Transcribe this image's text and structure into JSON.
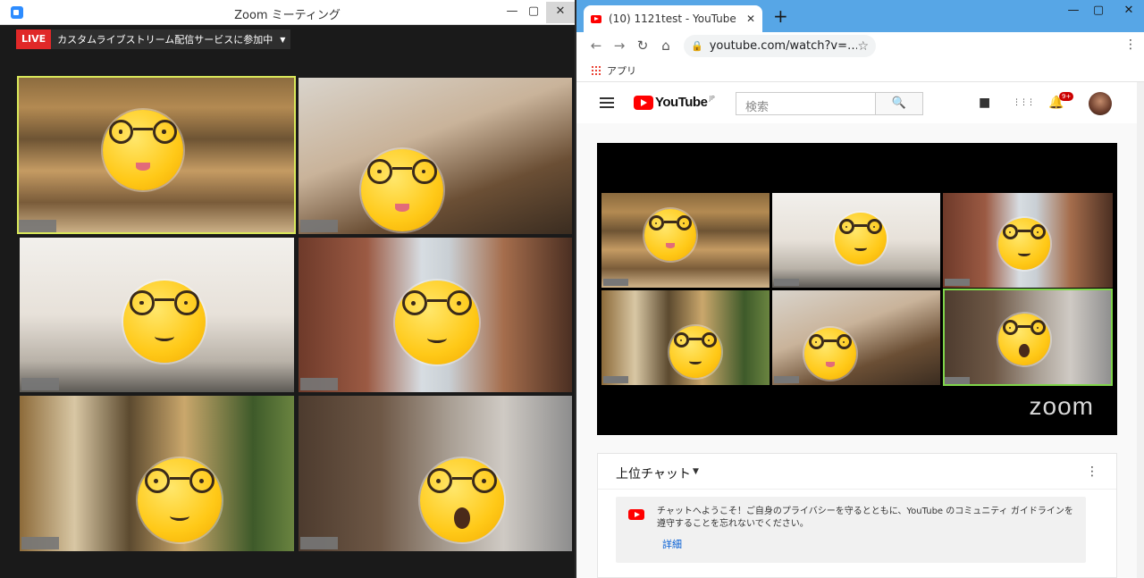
{
  "zoom": {
    "title": "Zoom ミーティング",
    "controls": {
      "minimize": "—",
      "maximize": "▢",
      "close": "✕"
    },
    "live_badge": "LIVE",
    "live_text": "カスタムライブストリーム配信サービスに参加中",
    "live_caret": "▼"
  },
  "chrome": {
    "tab_title": "(10) 1121test - YouTube",
    "tab_close": "✕",
    "new_tab": "+",
    "window_controls": {
      "minimize": "—",
      "maximize": "▢",
      "close": "✕"
    },
    "nav": {
      "back": "←",
      "forward": "→",
      "reload": "↻",
      "home": "⌂"
    },
    "lock": "🔒",
    "url": "youtube.com/watch?v=…",
    "star": "☆",
    "menu": "⋮",
    "bookmark_apps": "アプリ"
  },
  "youtube": {
    "logo_text": "YouTube",
    "logo_region": "JP",
    "search_placeholder": "検索",
    "search_icon": "🔍",
    "icons": {
      "create": "■",
      "apps": "⋮⋮⋮",
      "bell": "🔔",
      "notif_count": "9+"
    },
    "player_watermark": "zoom",
    "chat": {
      "title": "上位チャット",
      "caret": "▼",
      "menu": "⋮",
      "welcome": "チャットへようこそ！ご自身のプライバシーを守るとともに、YouTube のコミュニティ ガイドラインを遵守することを忘れないでください。",
      "more": "詳細"
    }
  }
}
